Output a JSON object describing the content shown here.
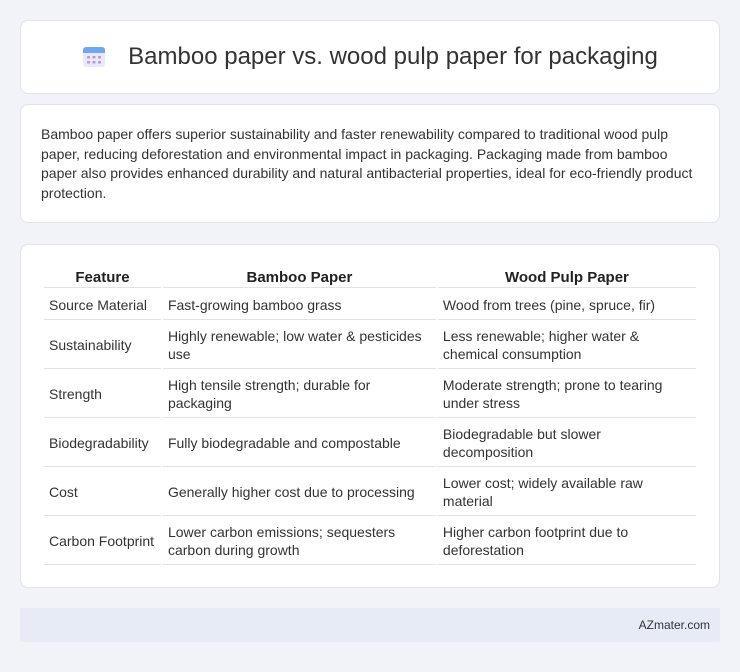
{
  "header": {
    "title": "Bamboo paper vs. wood pulp paper for packaging",
    "icon": "calendar-icon",
    "icon_color": "#8a7fd8"
  },
  "intro": {
    "text": "Bamboo paper offers superior sustainability and faster renewability compared to traditional wood pulp paper, reducing deforestation and environmental impact in packaging. Packaging made from bamboo paper also provides enhanced durability and natural antibacterial properties, ideal for eco-friendly product protection."
  },
  "table": {
    "headers": [
      "Feature",
      "Bamboo Paper",
      "Wood Pulp Paper"
    ],
    "rows": [
      [
        "Source Material",
        "Fast-growing bamboo grass",
        "Wood from trees (pine, spruce, fir)"
      ],
      [
        "Sustainability",
        "Highly renewable; low water & pesticides use",
        "Less renewable; higher water & chemical consumption"
      ],
      [
        "Strength",
        "High tensile strength; durable for packaging",
        "Moderate strength; prone to tearing under stress"
      ],
      [
        "Biodegradability",
        "Fully biodegradable and compostable",
        "Biodegradable but slower decomposition"
      ],
      [
        "Cost",
        "Generally higher cost due to processing",
        "Lower cost; widely available raw material"
      ],
      [
        "Carbon Footprint",
        "Lower carbon emissions; sequesters carbon during growth",
        "Higher carbon footprint due to deforestation"
      ]
    ]
  },
  "footer": {
    "brand": "AZmater.com"
  },
  "colors": {
    "background": "#f1f3f8",
    "card": "#ffffff",
    "footer_bg": "#e6ebf6"
  }
}
